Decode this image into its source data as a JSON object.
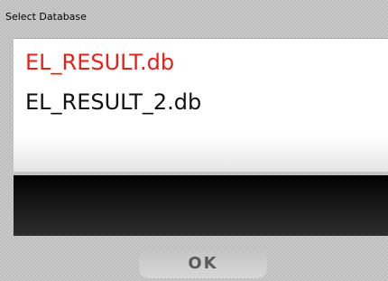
{
  "dialog": {
    "title": "Select Database",
    "databases": [
      {
        "label": "EL_RESULT.db",
        "color": "#e8201a",
        "selected": true
      },
      {
        "label": "EL_RESULT_2.db",
        "color": "#111111",
        "selected": false
      }
    ],
    "ok_label": "OK"
  },
  "colors": {
    "selected_text": "#e8201a",
    "normal_text": "#111111",
    "panel": "#000000",
    "button_text": "#5a5a5a"
  }
}
